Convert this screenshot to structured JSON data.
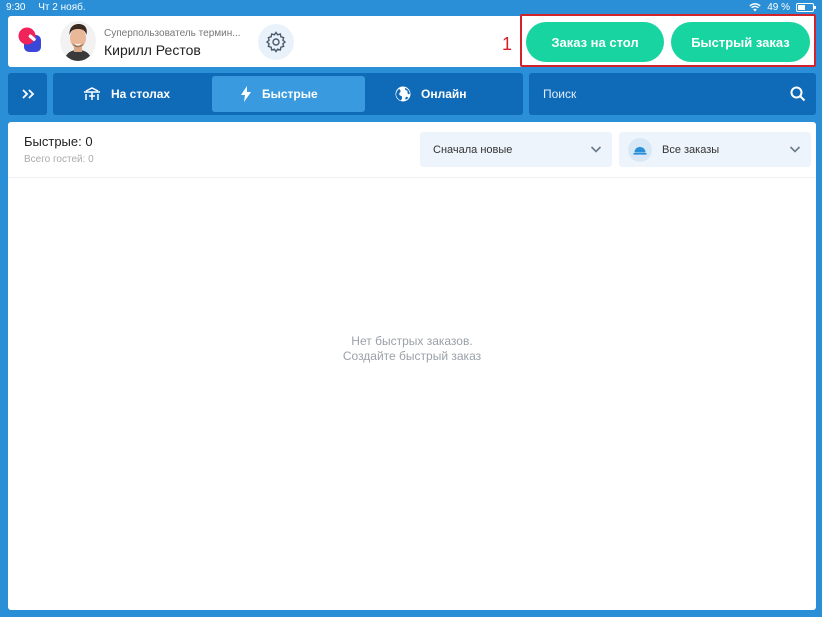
{
  "status_bar": {
    "time": "9:30",
    "date": "Чт 2 нояб.",
    "battery": "49 %"
  },
  "header": {
    "user_role": "Суперпользователь термин...",
    "user_name": "Кирилл Рестов",
    "annotation_number": "1",
    "order_table_button": "Заказ на стол",
    "quick_order_button": "Быстрый заказ"
  },
  "tabs": [
    {
      "label": "На столах"
    },
    {
      "label": "Быстрые"
    },
    {
      "label": "Онлайн"
    }
  ],
  "search": {
    "placeholder": "Поиск"
  },
  "panel": {
    "title": "Быстрые: 0",
    "subtitle": "Всего гостей: 0",
    "sort_value": "Сначала новые",
    "filter_value": "Все заказы",
    "empty_line1": "Нет быстрых заказов.",
    "empty_line2": "Создайте быстрый заказ"
  },
  "colors": {
    "background": "#2a8fd6",
    "bar": "#0f6ab8",
    "active_tab": "#3a9ae0",
    "accent_green": "#17d4a0",
    "annotation_red": "#d2232a"
  }
}
